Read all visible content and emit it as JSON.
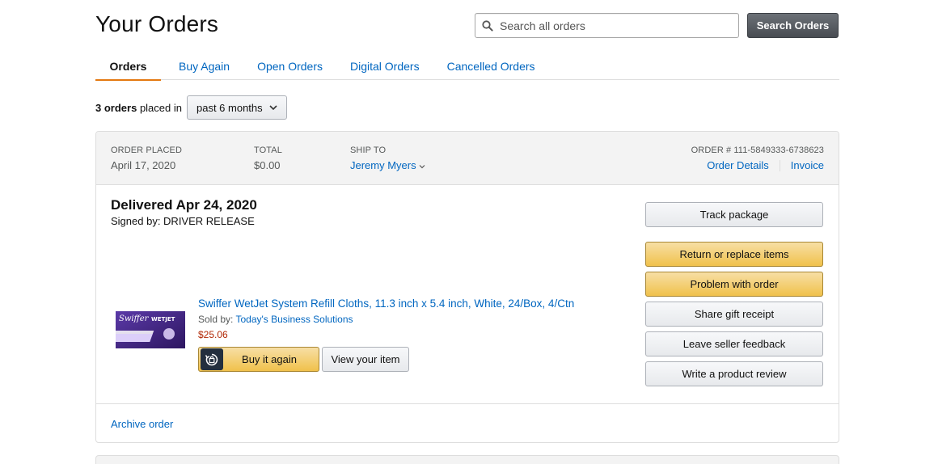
{
  "header": {
    "title": "Your Orders",
    "search_placeholder": "Search all orders",
    "search_button": "Search Orders"
  },
  "tabs": [
    {
      "label": "Orders",
      "active": true
    },
    {
      "label": "Buy Again",
      "active": false
    },
    {
      "label": "Open Orders",
      "active": false
    },
    {
      "label": "Digital Orders",
      "active": false
    },
    {
      "label": "Cancelled Orders",
      "active": false
    }
  ],
  "summary": {
    "count": "3 orders",
    "text": "placed in",
    "period": "past 6 months"
  },
  "order": {
    "placed_label": "ORDER PLACED",
    "placed_value": "April 17, 2020",
    "total_label": "TOTAL",
    "total_value": "$0.00",
    "ship_label": "SHIP TO",
    "ship_value": "Jeremy Myers",
    "number_label": "ORDER # 111-5849333-6738623",
    "details_link": "Order Details",
    "invoice_link": "Invoice",
    "status": "Delivered Apr 24, 2020",
    "signed": "Signed by: DRIVER RELEASE",
    "item": {
      "title": "Swiffer WetJet System Refill Cloths, 11.3 inch x 5.4 inch, White, 24/Box, 4/Ctn",
      "sold_by_label": "Sold by:",
      "seller": "Today's Business Solutions",
      "price": "$25.06",
      "thumb_brand": "Swiffer",
      "thumb_product": "WETJET"
    },
    "buy_again": "Buy it again",
    "view_item": "View your item",
    "actions": {
      "track": "Track package",
      "return": "Return or replace items",
      "problem": "Problem with order",
      "gift": "Share gift receipt",
      "seller_feedback": "Leave seller feedback",
      "review": "Write a product review"
    },
    "archive": "Archive order"
  },
  "colors": {
    "link": "#0066c0",
    "price": "#b12704",
    "tab_underline": "#e47911",
    "yellow_button": "#f0c14b",
    "dark_button": "#484c52"
  }
}
